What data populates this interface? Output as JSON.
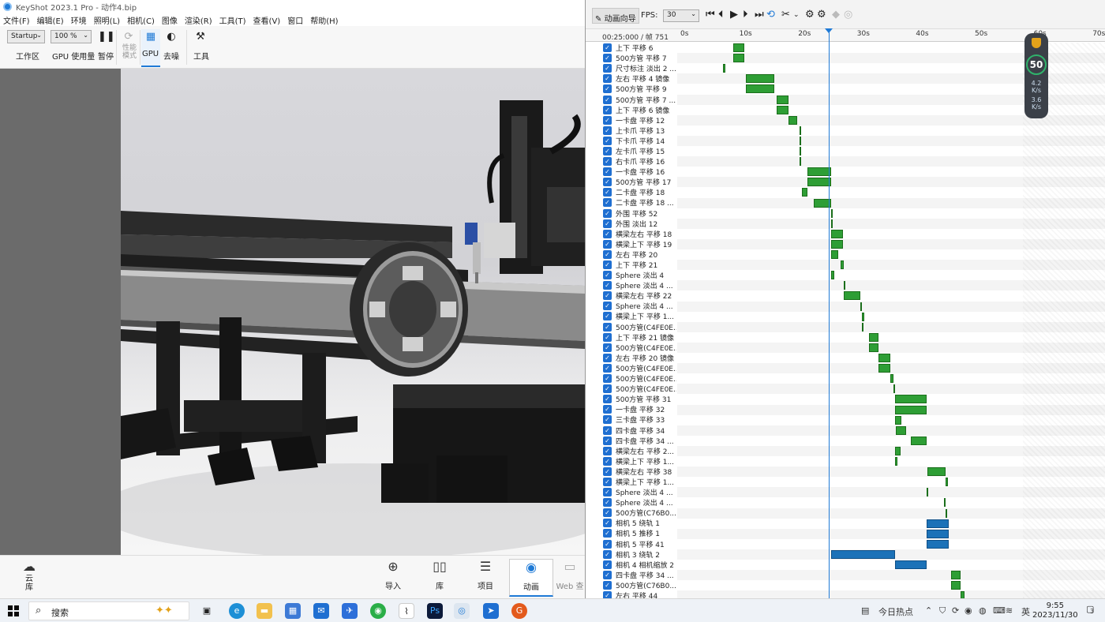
{
  "window": {
    "title": "KeyShot 2023.1 Pro  - 动作4.bip"
  },
  "menu": [
    "文件(F)",
    "编辑(E)",
    "环境",
    "照明(L)",
    "相机(C)",
    "图像",
    "渲染(R)",
    "工具(T)",
    "查看(V)",
    "窗口",
    "帮助(H)"
  ],
  "toolbar": {
    "workspace_value": "Startup",
    "workspace_label": "工作区",
    "zoom_value": "100 %",
    "gpu_usage_label": "GPU 使用量",
    "pause_label": "暂停",
    "perf_mode_label_1": "性能",
    "perf_mode_label_2": "模式",
    "gpu_label": "GPU",
    "denoise_label": "去噪",
    "tools_label": "工具"
  },
  "bottombar": {
    "cloud_label_1": "云",
    "cloud_label_2": "库",
    "import_label": "导入",
    "library_label": "库",
    "project_label": "项目",
    "animation_label": "动画",
    "web_label": "Web 查"
  },
  "animation": {
    "wizard_label": "动画向导",
    "fps_label": "FPS:",
    "fps_value": "30",
    "timecode": "00:25:000 / 帧 751",
    "ticks": [
      "0s",
      "10s",
      "20s",
      "30s",
      "40s",
      "50s",
      "60s",
      "70s"
    ],
    "perf": {
      "score": "50",
      "up_rate": "4.2",
      "up_unit": "K/s",
      "down_rate": "3.6",
      "down_unit": "K/s"
    },
    "tracks": [
      {
        "label": "上下 平移 6",
        "start": 9.0,
        "end": 10.8,
        "color": "green"
      },
      {
        "label": "500方管 平移 7",
        "start": 9.0,
        "end": 10.8,
        "color": "green"
      },
      {
        "label": "尺寸标注 淡出 2 ...",
        "start": 7.3,
        "end": 7.6,
        "color": "green"
      },
      {
        "label": "左右 平移 4 镜像",
        "start": 11.1,
        "end": 15.9,
        "color": "green"
      },
      {
        "label": "500方管 平移 9",
        "start": 11.1,
        "end": 15.9,
        "color": "green"
      },
      {
        "label": "500方管 平移 7 ...",
        "start": 16.4,
        "end": 18.4,
        "color": "green"
      },
      {
        "label": "上下 平移 6 镜像",
        "start": 16.4,
        "end": 18.4,
        "color": "green"
      },
      {
        "label": "一卡盘 平移 12",
        "start": 18.4,
        "end": 19.8,
        "color": "green"
      },
      {
        "label": "上卡爪 平移 13",
        "start": 20.2,
        "end": 20.4,
        "color": "green"
      },
      {
        "label": "下卡爪 平移 14",
        "start": 20.2,
        "end": 20.4,
        "color": "green"
      },
      {
        "label": "左卡爪 平移 15",
        "start": 20.2,
        "end": 20.4,
        "color": "green"
      },
      {
        "label": "右卡爪 平移 16",
        "start": 20.2,
        "end": 20.4,
        "color": "green"
      },
      {
        "label": "一卡盘 平移 16",
        "start": 21.6,
        "end": 25.6,
        "color": "green"
      },
      {
        "label": "500方管 平移 17",
        "start": 21.6,
        "end": 25.6,
        "color": "green"
      },
      {
        "label": "二卡盘 平移 18",
        "start": 20.6,
        "end": 21.6,
        "color": "green"
      },
      {
        "label": "二卡盘 平移 18 ...",
        "start": 22.6,
        "end": 25.6,
        "color": "green"
      },
      {
        "label": "外围 平移 52",
        "start": 25.6,
        "end": 25.8,
        "color": "green"
      },
      {
        "label": "外围 淡出 12",
        "start": 25.6,
        "end": 25.8,
        "color": "green"
      },
      {
        "label": "横梁左右 平移 18",
        "start": 25.6,
        "end": 27.6,
        "color": "green"
      },
      {
        "label": "横梁上下 平移 19",
        "start": 25.6,
        "end": 27.6,
        "color": "green"
      },
      {
        "label": "左右 平移 20",
        "start": 25.6,
        "end": 26.8,
        "color": "green"
      },
      {
        "label": "上下 平移 21",
        "start": 27.2,
        "end": 27.8,
        "color": "green"
      },
      {
        "label": "Sphere 淡出 4",
        "start": 25.6,
        "end": 26.2,
        "color": "green"
      },
      {
        "label": "Sphere 淡出 4 ...",
        "start": 27.8,
        "end": 28.0,
        "color": "green"
      },
      {
        "label": "横梁左右 平移 22",
        "start": 27.8,
        "end": 30.6,
        "color": "green"
      },
      {
        "label": "Sphere 淡出 4 ...",
        "start": 30.6,
        "end": 30.8,
        "color": "green"
      },
      {
        "label": "横梁上下 平移 1...",
        "start": 30.8,
        "end": 31.2,
        "color": "green"
      },
      {
        "label": "500方管(C4FE0E...",
        "start": 30.8,
        "end": 31.0,
        "color": "green"
      },
      {
        "label": "上下 平移 21 镜像",
        "start": 32.0,
        "end": 33.6,
        "color": "green"
      },
      {
        "label": "500方管(C4FE0E...",
        "start": 32.0,
        "end": 33.6,
        "color": "green"
      },
      {
        "label": "左右 平移 20 镜像",
        "start": 33.6,
        "end": 35.6,
        "color": "green"
      },
      {
        "label": "500方管(C4FE0E...",
        "start": 33.6,
        "end": 35.6,
        "color": "green"
      },
      {
        "label": "500方管(C4FE0E...",
        "start": 35.6,
        "end": 36.2,
        "color": "green"
      },
      {
        "label": "500方管(C4FE0E...",
        "start": 36.2,
        "end": 36.4,
        "color": "green"
      },
      {
        "label": "500方管 平移 31",
        "start": 36.4,
        "end": 41.8,
        "color": "green"
      },
      {
        "label": "一卡盘 平移 32",
        "start": 36.4,
        "end": 41.8,
        "color": "green"
      },
      {
        "label": "三卡盘 平移 33",
        "start": 36.4,
        "end": 37.6,
        "color": "green"
      },
      {
        "label": "四卡盘 平移 34",
        "start": 36.6,
        "end": 38.4,
        "color": "green"
      },
      {
        "label": "四卡盘 平移 34 ...",
        "start": 39.2,
        "end": 41.8,
        "color": "green"
      },
      {
        "label": "横梁左右 平移 2...",
        "start": 36.4,
        "end": 37.4,
        "color": "green"
      },
      {
        "label": "横梁上下 平移 1...",
        "start": 36.4,
        "end": 36.8,
        "color": "green"
      },
      {
        "label": "横梁左右 平移 38",
        "start": 42.0,
        "end": 45.0,
        "color": "green"
      },
      {
        "label": "横梁上下 平移 1...",
        "start": 45.0,
        "end": 45.4,
        "color": "green"
      },
      {
        "label": "Sphere 淡出 4 ...",
        "start": 41.8,
        "end": 42.0,
        "color": "green"
      },
      {
        "label": "Sphere 淡出 4 ...",
        "start": 44.8,
        "end": 45.0,
        "color": "green"
      },
      {
        "label": "500方管(C76B0...",
        "start": 45.0,
        "end": 45.2,
        "color": "green"
      },
      {
        "label": "相机 5 绕轨 1",
        "start": 41.8,
        "end": 45.6,
        "color": "blue"
      },
      {
        "label": "相机 5 推移 1",
        "start": 41.8,
        "end": 45.6,
        "color": "blue"
      },
      {
        "label": "相机 5 平移 41",
        "start": 41.8,
        "end": 45.6,
        "color": "blue"
      },
      {
        "label": "相机 3 绕轨 2",
        "start": 25.6,
        "end": 36.4,
        "color": "blue"
      },
      {
        "label": "相机 4 相机缩放 2",
        "start": 36.4,
        "end": 41.8,
        "color": "blue"
      },
      {
        "label": "四卡盘 平移 34 ...",
        "start": 46.0,
        "end": 47.6,
        "color": "green"
      },
      {
        "label": "500方管(C76B0...",
        "start": 46.0,
        "end": 47.6,
        "color": "green"
      },
      {
        "label": "左右 平移 44",
        "start": 47.6,
        "end": 48.2,
        "color": "green"
      }
    ]
  },
  "taskbar": {
    "search_label": "搜索",
    "news_label": "今日热点",
    "ime_label": "英",
    "time": "9:55",
    "date": "2023/11/30",
    "notif_count": "3"
  },
  "colors": {
    "accent": "#1f7ad6",
    "clip_green": "#2e9e35",
    "clip_blue": "#1c72b8"
  }
}
